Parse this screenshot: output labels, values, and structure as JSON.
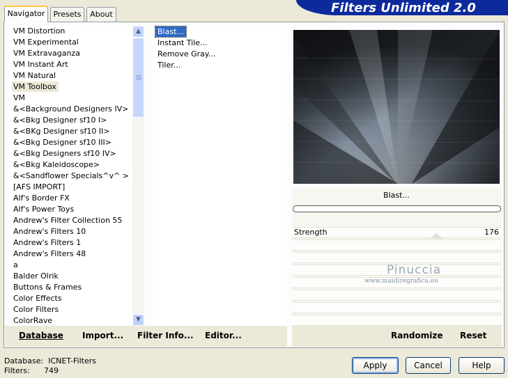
{
  "banner": "Filters Unlimited 2.0",
  "tabs": [
    {
      "label": "Navigator"
    },
    {
      "label": "Presets"
    },
    {
      "label": "About"
    }
  ],
  "categories": [
    "VM Distortion",
    "VM Experimental",
    "VM Extravaganza",
    "VM Instant Art",
    "VM Natural",
    "VM Toolbox",
    "VM",
    "&<Background Designers IV>",
    "&<Bkg Designer sf10 I>",
    "&<BKg Designer sf10 II>",
    "&<Bkg Designer sf10 III>",
    "&<Bkg Designers sf10 IV>",
    "&<Bkg Kaleidoscope>",
    "&<Sandflower Specials^v^ >",
    "[AFS IMPORT]",
    "Alf's Border FX",
    "Alf's Power Toys",
    "Andrew's Filter Collection 55",
    "Andrew's Filters 10",
    "Andrew's Filters 1",
    "Andrew's Filters 48",
    "a",
    "Balder Olrik",
    "Buttons & Frames",
    "Color Effects",
    "Color Filters",
    "ColorRave"
  ],
  "selected_category": "VM Toolbox",
  "filters": [
    "Blast...",
    "Instant Tile...",
    "Remove Gray...",
    "Tiler..."
  ],
  "selected_filter": "Blast...",
  "left_buttons": {
    "database": "Database",
    "import": "Import...",
    "filter_info": "Filter Info...",
    "editor": "Editor..."
  },
  "right_buttons": {
    "randomize": "Randomize",
    "reset": "Reset"
  },
  "filter_title": "Blast...",
  "params": [
    {
      "label": "Strength",
      "value": "176"
    }
  ],
  "watermark": {
    "name": "Pinuccia",
    "url": "www.maidiregrafica.eu"
  },
  "status": {
    "database_label": "Database:",
    "database_value": "ICNET-Filters",
    "filters_label": "Filters:",
    "filters_value": "749"
  },
  "dialog_buttons": {
    "apply": "Apply",
    "cancel": "Cancel",
    "help": "Help"
  }
}
